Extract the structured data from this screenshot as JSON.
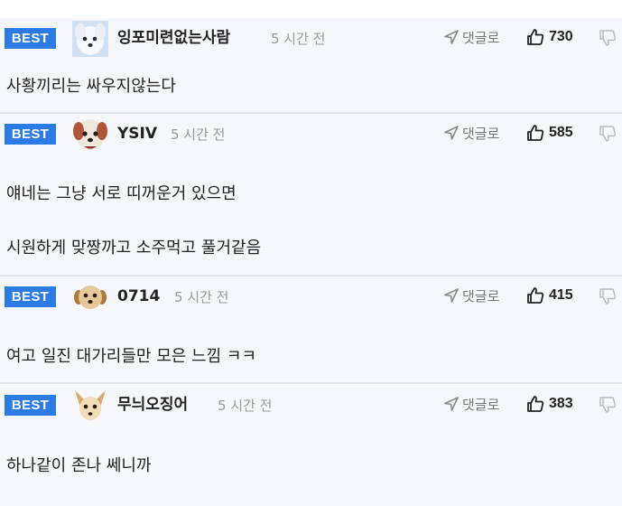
{
  "comments": [
    {
      "badge": "BEST",
      "nickname": "잉포미련없는사람",
      "time": "5 시간 전",
      "reply_label": "댓글로",
      "likes": "730",
      "avatar": "white-dog-avatar",
      "lines": [
        "사황끼리는 싸우지않는다"
      ]
    },
    {
      "badge": "BEST",
      "nickname": "YSIV",
      "time": "5 시간 전",
      "reply_label": "댓글로",
      "likes": "585",
      "avatar": "white-dog-avatar",
      "lines": [
        "얘네는 그냥 서로 띠꺼운거 있으면",
        "시원하게 맞짱까고 소주먹고 풀거같음"
      ]
    },
    {
      "badge": "BEST",
      "nickname": "0714",
      "time": "5 시간 전",
      "reply_label": "댓글로",
      "likes": "415",
      "avatar": "puppy-avatar",
      "lines": [
        "여고 일진 대가리들만 모은 느낌 ㅋㅋ"
      ]
    },
    {
      "badge": "BEST",
      "nickname": "무늬오징어",
      "time": "5 시간 전",
      "reply_label": "댓글로",
      "likes": "383",
      "avatar": "chihuahua-avatar",
      "lines": [
        "하나같이 존나 쎄니까"
      ]
    }
  ],
  "colors": {
    "best_badge": "#2c7be5",
    "row_background": "#f6f7fa",
    "separator": "#e2e4ea",
    "time_text": "#999999"
  }
}
